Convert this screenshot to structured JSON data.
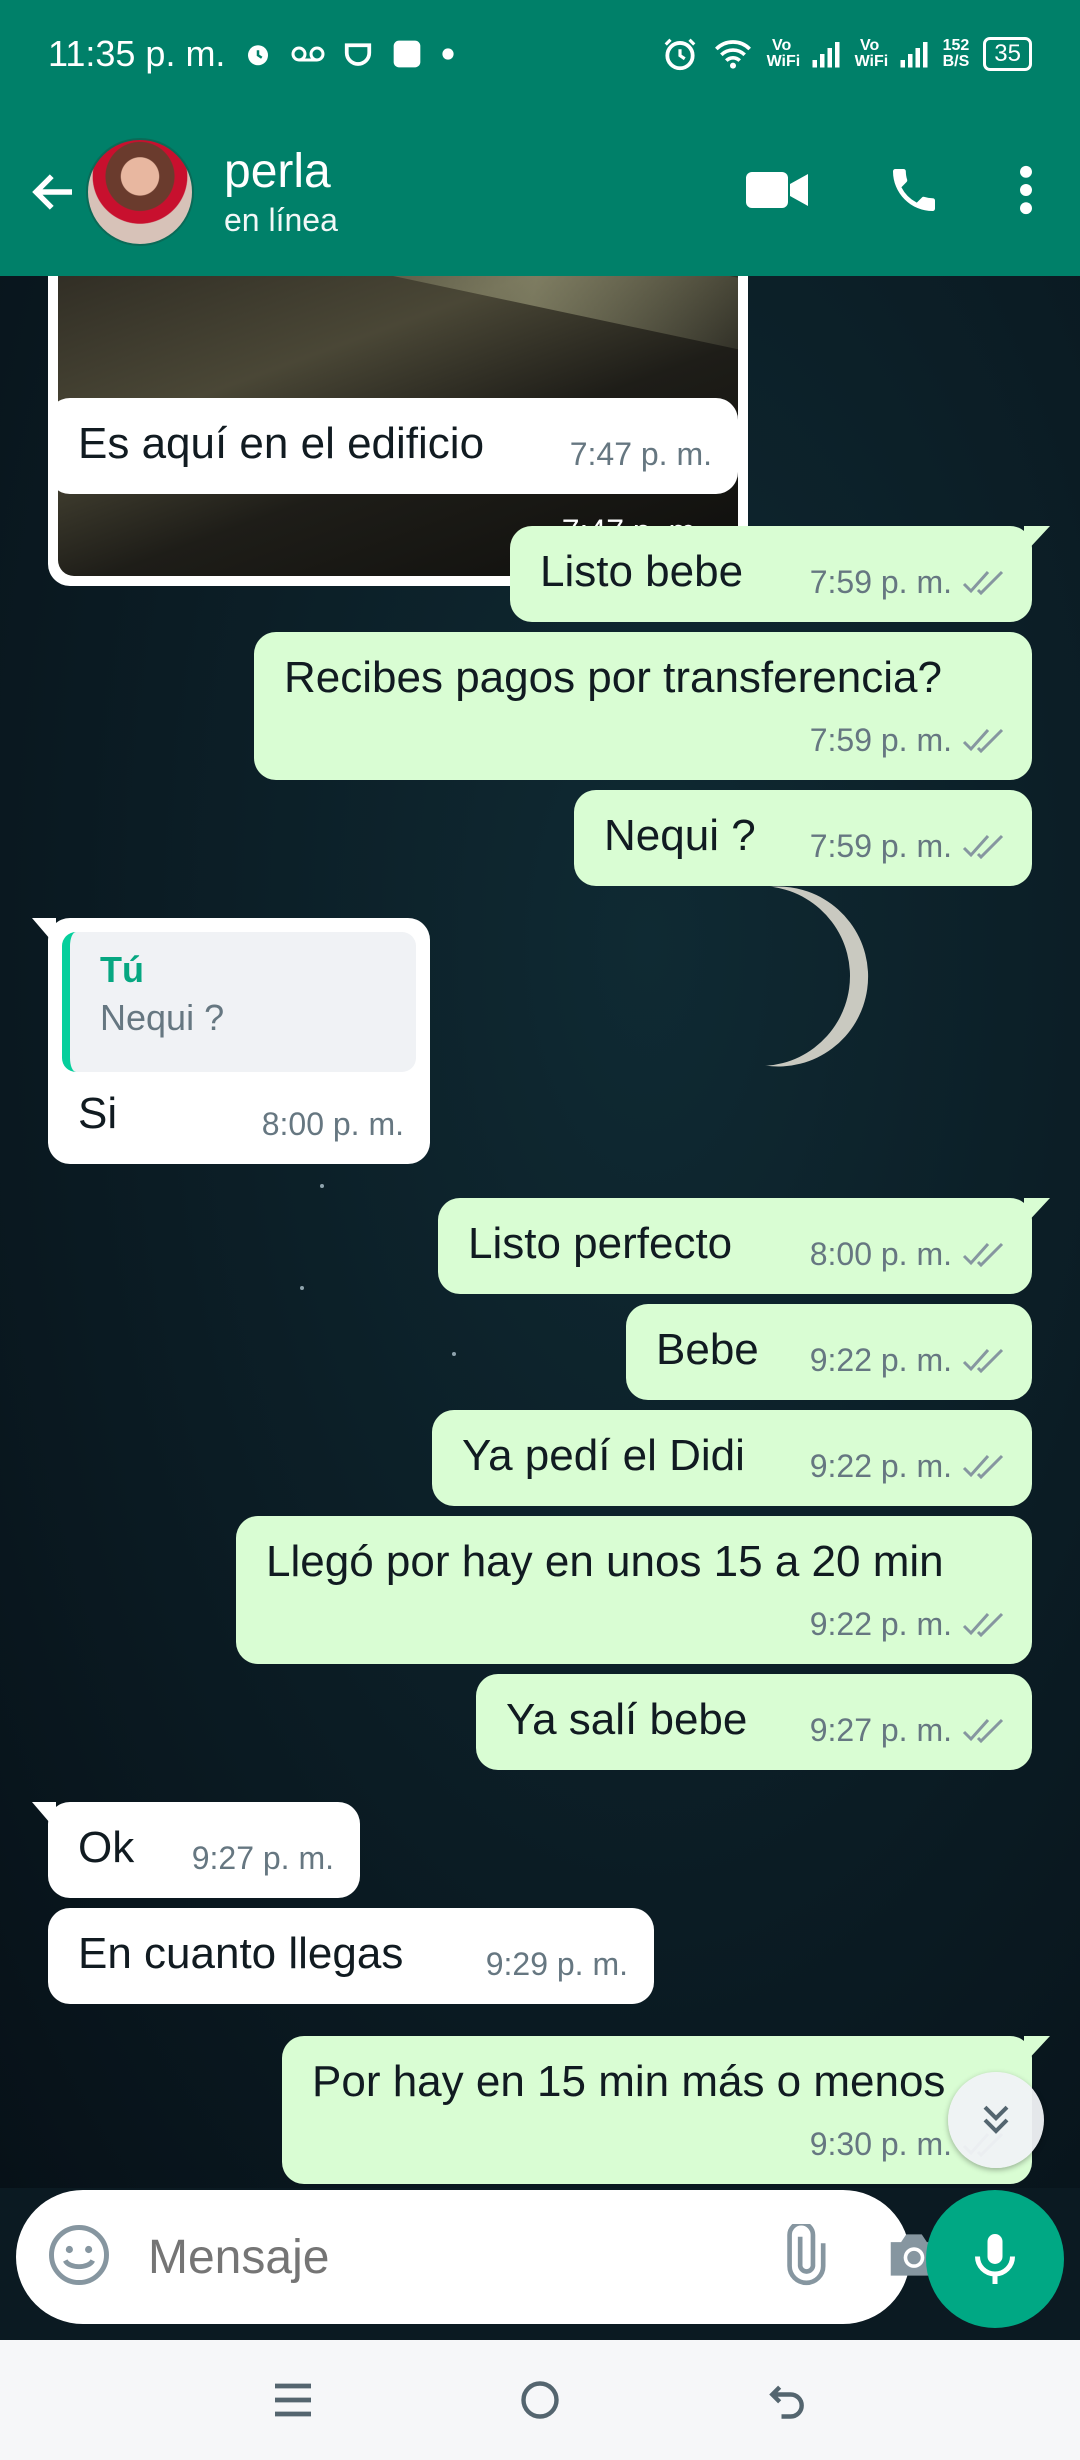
{
  "status_bar": {
    "time": "11:35 p. m.",
    "vowifi_1": "Vo WiFi",
    "vowifi_2": "Vo WiFi",
    "speed_value": "152",
    "speed_unit": "B/S",
    "battery": "35"
  },
  "header": {
    "contact_name": "perla",
    "status": "en línea"
  },
  "messages": [
    {
      "id": "m0",
      "type": "image",
      "direction": "in",
      "time": "7:47 p. m."
    },
    {
      "id": "m1",
      "direction": "in",
      "text": "Es aquí en el edificio",
      "time": "7:47 p. m."
    },
    {
      "id": "m2",
      "direction": "out",
      "text": "Listo bebe",
      "time": "7:59 p. m.",
      "status": "read"
    },
    {
      "id": "m3",
      "direction": "out",
      "text": "Recibes pagos por transferencia?",
      "time": "7:59 p. m.",
      "status": "read"
    },
    {
      "id": "m4",
      "direction": "out",
      "text": "Nequi ?",
      "time": "7:59 p. m.",
      "status": "read"
    },
    {
      "id": "m5",
      "direction": "in",
      "reply_to": {
        "author": "Tú",
        "text": "Nequi ?"
      },
      "text": "Si",
      "time": "8:00 p. m."
    },
    {
      "id": "m6",
      "direction": "out",
      "text": "Listo perfecto",
      "time": "8:00 p. m.",
      "status": "read"
    },
    {
      "id": "m7",
      "direction": "out",
      "text": "Bebe",
      "time": "9:22 p. m.",
      "status": "read"
    },
    {
      "id": "m8",
      "direction": "out",
      "text": "Ya pedí el Didi",
      "time": "9:22 p. m.",
      "status": "read"
    },
    {
      "id": "m9",
      "direction": "out",
      "text": "Llegó por hay en unos 15 a 20 min",
      "time": "9:22 p. m.",
      "status": "read"
    },
    {
      "id": "m10",
      "direction": "out",
      "text": "Ya salí bebe",
      "time": "9:27 p. m.",
      "status": "read"
    },
    {
      "id": "m11",
      "direction": "in",
      "text": "Ok",
      "time": "9:27 p. m."
    },
    {
      "id": "m12",
      "direction": "in",
      "text": "En cuanto llegas",
      "time": "9:29 p. m."
    },
    {
      "id": "m13",
      "direction": "out",
      "text": "Por hay en 15 min más o menos",
      "time": "9:30 p. m.",
      "status": "read"
    }
  ],
  "composer": {
    "placeholder": "Mensaje"
  },
  "colors": {
    "header": "#008069",
    "outgoing_bubble": "#d9fdd3",
    "incoming_bubble": "#ffffff",
    "read_tick": "#8696a0",
    "mic_button": "#00a884"
  }
}
